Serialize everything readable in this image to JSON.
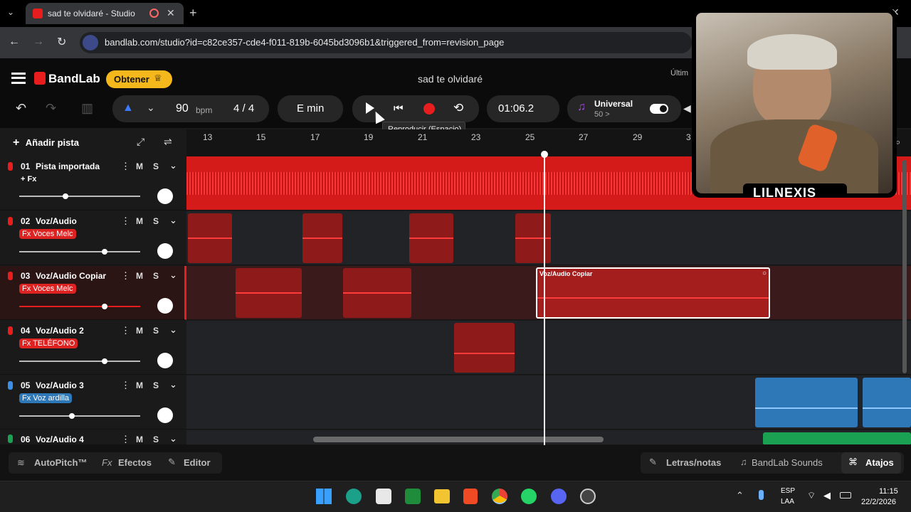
{
  "browser": {
    "tab_title": "sad te olvidaré - Studio",
    "url": "bandlab.com/studio?id=c82ce357-cde4-f011-819b-6045bd3096b1&triggered_from=revision_page"
  },
  "app": {
    "brand": "BandLab",
    "obtener_label": "Obtener",
    "project_title": "sad te olvidaré",
    "ultim_label": "Últim"
  },
  "toolbar": {
    "bpm_value": "90",
    "bpm_unit": "bpm",
    "time_sig": "4 / 4",
    "key": "E min",
    "time": "01:06.2",
    "tooltip": "Reproducir (Espacio)",
    "universal_label": "Universal",
    "universal_sub": "50 >"
  },
  "tracks_header": {
    "add_track_label": "Añadir pista"
  },
  "ruler": {
    "marks": [
      "13",
      "15",
      "17",
      "19",
      "21",
      "23",
      "25",
      "27",
      "29",
      "3"
    ]
  },
  "tracks": [
    {
      "num": "01",
      "name": "Pista importada",
      "fx": "+ Fx",
      "fx_style": "plain"
    },
    {
      "num": "02",
      "name": "Voz/Audio",
      "fx": "Fx Voces Melc",
      "fx_style": "red"
    },
    {
      "num": "03",
      "name": "Voz/Audio Copiar",
      "fx": "Fx Voces Melc",
      "fx_style": "red"
    },
    {
      "num": "04",
      "name": "Voz/Audio 2",
      "fx": "Fx TELÉFONO",
      "fx_style": "red"
    },
    {
      "num": "05",
      "name": "Voz/Audio 3",
      "fx": "Fx Voz ardilla",
      "fx_style": "blue"
    },
    {
      "num": "06",
      "name": "Voz/Audio 4",
      "fx": "",
      "fx_style": "none"
    }
  ],
  "ms_labels": {
    "m": "M",
    "s": "S"
  },
  "selected_clip_label": "Voz/Audio Copiar",
  "bottom": {
    "autopitch": "AutoPitch™",
    "efectos": "Efectos",
    "editor": "Editor",
    "letras": "Letras/notas",
    "sounds": "BandLab Sounds",
    "atajos": "Atajos"
  },
  "webcam": {
    "name": "LILNEXIS"
  },
  "taskbar": {
    "lang1": "ESP",
    "lang2": "LAA",
    "clock_time": "11:15",
    "clock_date": "22/2/2026"
  },
  "colors": {
    "accent_red": "#e81e1e",
    "obtener_yellow": "#f5b81c",
    "blue_clip": "#2f78b8",
    "green_clip": "#1aa152"
  }
}
